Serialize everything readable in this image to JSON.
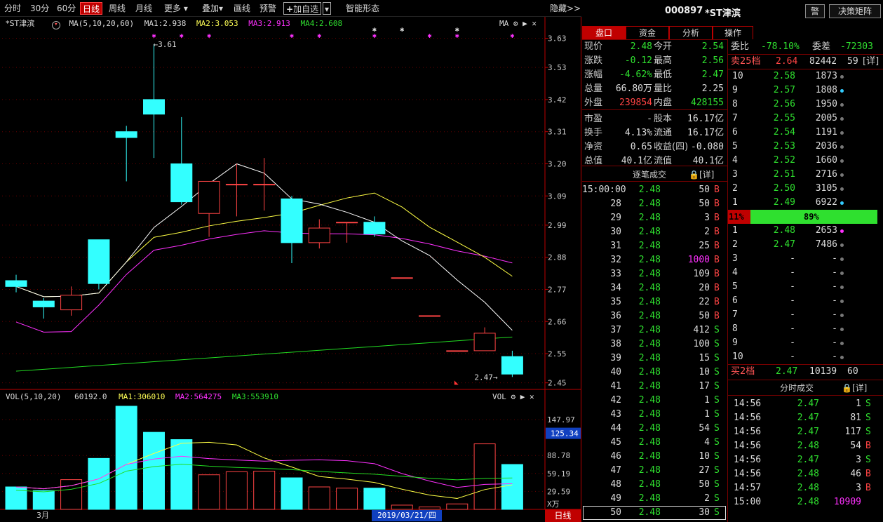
{
  "toolbar": {
    "items": [
      "分时",
      "30分",
      "60分",
      "日线",
      "周线",
      "月线",
      "更多",
      "叠加",
      "画线",
      "预警",
      "加自选",
      "智能形态"
    ],
    "active": "日线",
    "hide_label": "隐藏>>"
  },
  "kline": {
    "name": "*ST津滨",
    "ma_label": "MA(5,10,20,60)",
    "ma1": "MA1:2.938",
    "ma2": "MA2:3.053",
    "ma3": "MA3:2.913",
    "ma4": "MA4:2.608",
    "ma_tag": "MA",
    "price_ticks": [
      "3.63",
      "3.53",
      "3.42",
      "3.31",
      "3.20",
      "3.09",
      "2.99",
      "2.88",
      "2.77",
      "2.66",
      "2.55",
      "2.45"
    ],
    "high_annot": "3.61",
    "low_annot": "2.47"
  },
  "vol": {
    "label": "VOL(5,10,20)",
    "value": "60192.0",
    "ma1": "MA1:306010",
    "ma2": "MA2:564275",
    "ma3": "MA3:553910",
    "tag": "VOL",
    "ticks": [
      "147.97",
      "88.78",
      "59.19",
      "29.59"
    ],
    "current": "125.34",
    "unit": "X万"
  },
  "footer": {
    "month": "3月",
    "date": "2019/03/21/四",
    "period": "日线"
  },
  "chart_data": {
    "type": "candlestick",
    "candles": [
      {
        "o": 2.8,
        "h": 2.82,
        "l": 2.76,
        "c": 2.78
      },
      {
        "o": 2.73,
        "h": 2.74,
        "l": 2.67,
        "c": 2.71
      },
      {
        "o": 2.7,
        "h": 2.78,
        "l": 2.68,
        "c": 2.75
      },
      {
        "o": 2.94,
        "h": 2.94,
        "l": 2.77,
        "c": 2.79
      },
      {
        "o": 3.31,
        "h": 3.33,
        "l": 3.14,
        "c": 3.29
      },
      {
        "o": 3.42,
        "h": 3.61,
        "l": 3.22,
        "c": 3.37
      },
      {
        "o": 3.2,
        "h": 3.36,
        "l": 3.06,
        "c": 3.07
      },
      {
        "o": 3.03,
        "h": 3.08,
        "l": 2.95,
        "c": 3.14
      },
      {
        "o": 3.13,
        "h": 3.2,
        "l": 3.02,
        "c": 3.13
      },
      {
        "o": 3.13,
        "h": 3.22,
        "l": 3.04,
        "c": 3.13
      },
      {
        "o": 3.08,
        "h": 3.09,
        "l": 2.86,
        "c": 2.93
      },
      {
        "o": 2.93,
        "h": 3.01,
        "l": 2.91,
        "c": 2.98
      },
      {
        "o": 3.0,
        "h": 3.0,
        "l": 2.93,
        "c": 3.0
      },
      {
        "o": 3.0,
        "h": 3.02,
        "l": 2.95,
        "c": 2.96
      },
      {
        "o": 2.81,
        "h": 2.81,
        "l": 2.81,
        "c": 2.81
      },
      {
        "o": 2.68,
        "h": 2.68,
        "l": 2.68,
        "c": 2.68
      },
      {
        "o": 2.56,
        "h": 2.56,
        "l": 2.56,
        "c": 2.56
      },
      {
        "o": 2.56,
        "h": 2.64,
        "l": 2.56,
        "c": 2.62
      },
      {
        "o": 2.54,
        "h": 2.56,
        "l": 2.47,
        "c": 2.48
      }
    ],
    "volume": [
      37,
      31,
      49,
      84,
      170,
      127,
      115,
      57,
      62,
      63,
      52,
      37,
      35,
      35,
      7,
      4,
      9,
      108,
      74
    ],
    "ylim": [
      2.43,
      3.66
    ],
    "vol_ylim": [
      0,
      148
    ]
  },
  "quote": {
    "code": "000897",
    "name": "*ST津滨",
    "alert_btn": "警",
    "matrix_btn": "决策矩阵",
    "tabs": [
      "盘口",
      "资金",
      "分析",
      "操作"
    ],
    "stats": [
      [
        "现价",
        "2.48",
        "今开",
        "2.54"
      ],
      [
        "涨跌",
        "-0.12",
        "最高",
        "2.56"
      ],
      [
        "涨幅",
        "-4.62%",
        "最低",
        "2.47"
      ],
      [
        "总量",
        "66.80万",
        "量比",
        "2.25"
      ],
      [
        "外盘",
        "239854",
        "内盘",
        "428155"
      ],
      [
        "市盈",
        "-",
        "股本",
        "16.17亿"
      ],
      [
        "换手",
        "4.13%",
        "流通",
        "16.17亿"
      ],
      [
        "净资",
        "0.65",
        "收益(四)",
        "-0.080"
      ],
      [
        "总值",
        "40.1亿",
        "流值",
        "40.1亿"
      ]
    ],
    "tick_title": "逐笔成交",
    "detail": "[详]",
    "ticks": [
      [
        "15:00:00",
        "2.48",
        "50",
        "B"
      ],
      [
        "28",
        "2.48",
        "50",
        "B"
      ],
      [
        "29",
        "2.48",
        "3",
        "B"
      ],
      [
        "30",
        "2.48",
        "2",
        "B"
      ],
      [
        "31",
        "2.48",
        "25",
        "B"
      ],
      [
        "32",
        "2.48",
        "1000",
        "B"
      ],
      [
        "33",
        "2.48",
        "109",
        "B"
      ],
      [
        "34",
        "2.48",
        "20",
        "B"
      ],
      [
        "35",
        "2.48",
        "22",
        "B"
      ],
      [
        "36",
        "2.48",
        "50",
        "B"
      ],
      [
        "37",
        "2.48",
        "412",
        "S"
      ],
      [
        "38",
        "2.48",
        "100",
        "S"
      ],
      [
        "39",
        "2.48",
        "15",
        "S"
      ],
      [
        "40",
        "2.48",
        "10",
        "S"
      ],
      [
        "41",
        "2.48",
        "17",
        "S"
      ],
      [
        "42",
        "2.48",
        "1",
        "S"
      ],
      [
        "43",
        "2.48",
        "1",
        "S"
      ],
      [
        "44",
        "2.48",
        "54",
        "S"
      ],
      [
        "45",
        "2.48",
        "4",
        "S"
      ],
      [
        "46",
        "2.48",
        "10",
        "S"
      ],
      [
        "47",
        "2.48",
        "27",
        "S"
      ],
      [
        "48",
        "2.48",
        "50",
        "S"
      ],
      [
        "49",
        "2.48",
        "2",
        "S"
      ],
      [
        "50",
        "2.48",
        "30",
        "S"
      ]
    ],
    "webi_label": "委比",
    "webi": "-78.10%",
    "weicha_label": "委差",
    "weicha": "-72303",
    "sell25_label": "卖25档",
    "sell25_price": "2.64",
    "sell25_vol": "82442",
    "sell25_n": "59",
    "sell25_detail": "[详]",
    "asks": [
      [
        "10",
        "2.58",
        "1873",
        ""
      ],
      [
        "9",
        "2.57",
        "1808",
        "c"
      ],
      [
        "8",
        "2.56",
        "1950",
        ""
      ],
      [
        "7",
        "2.55",
        "2005",
        ""
      ],
      [
        "6",
        "2.54",
        "1191",
        ""
      ],
      [
        "5",
        "2.53",
        "2036",
        ""
      ],
      [
        "4",
        "2.52",
        "1660",
        ""
      ],
      [
        "3",
        "2.51",
        "2716",
        ""
      ],
      [
        "2",
        "2.50",
        "3105",
        ""
      ],
      [
        "1",
        "2.49",
        "6922",
        "c"
      ]
    ],
    "ratio_left": "11%",
    "ratio_right": "89%",
    "bids": [
      [
        "1",
        "2.48",
        "2653",
        "m"
      ],
      [
        "2",
        "2.47",
        "7486",
        ""
      ],
      [
        "3",
        "-",
        "-",
        ""
      ],
      [
        "4",
        "-",
        "-",
        ""
      ],
      [
        "5",
        "-",
        "-",
        ""
      ],
      [
        "6",
        "-",
        "-",
        ""
      ],
      [
        "7",
        "-",
        "-",
        ""
      ],
      [
        "8",
        "-",
        "-",
        ""
      ],
      [
        "9",
        "-",
        "-",
        ""
      ],
      [
        "10",
        "-",
        "-",
        ""
      ]
    ],
    "buy2_label": "买2档",
    "buy2_price": "2.47",
    "buy2_vol": "10139",
    "buy2_n": "60",
    "minute_title": "分时成交",
    "minute": [
      [
        "14:56",
        "2.47",
        "1",
        "S"
      ],
      [
        "14:56",
        "2.47",
        "81",
        "S"
      ],
      [
        "14:56",
        "2.47",
        "117",
        "S"
      ],
      [
        "14:56",
        "2.48",
        "54",
        "B"
      ],
      [
        "14:56",
        "2.47",
        "3",
        "S"
      ],
      [
        "14:56",
        "2.48",
        "46",
        "B"
      ],
      [
        "14:57",
        "2.48",
        "3",
        "B"
      ],
      [
        "15:00",
        "2.48",
        "10909",
        ""
      ]
    ]
  }
}
